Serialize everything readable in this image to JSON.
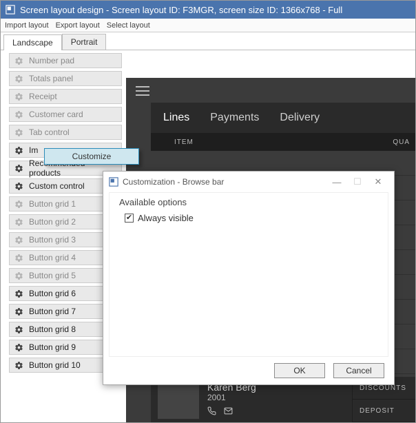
{
  "titlebar": {
    "text": "Screen layout design - Screen layout ID: F3MGR, screen size ID: 1366x768 - Full"
  },
  "toolbar": {
    "import": "Import layout",
    "export": "Export layout",
    "select": "Select layout"
  },
  "tabs": {
    "landscape": "Landscape",
    "portrait": "Portrait"
  },
  "sidebar": [
    {
      "label": "Number pad",
      "enabled": false
    },
    {
      "label": "Totals panel",
      "enabled": false
    },
    {
      "label": "Receipt",
      "enabled": false
    },
    {
      "label": "Customer card",
      "enabled": false
    },
    {
      "label": "Tab control",
      "enabled": false
    },
    {
      "label": "Im",
      "enabled": true
    },
    {
      "label": "Recommended products",
      "enabled": true
    },
    {
      "label": "Custom control",
      "enabled": true
    },
    {
      "label": "Button grid 1",
      "enabled": false
    },
    {
      "label": "Button grid 2",
      "enabled": false
    },
    {
      "label": "Button grid 3",
      "enabled": false
    },
    {
      "label": "Button grid 4",
      "enabled": false
    },
    {
      "label": "Button grid 5",
      "enabled": false
    },
    {
      "label": "Button grid 6",
      "enabled": true
    },
    {
      "label": "Button grid 7",
      "enabled": true
    },
    {
      "label": "Button grid 8",
      "enabled": true
    },
    {
      "label": "Button grid 9",
      "enabled": true
    },
    {
      "label": "Button grid 10",
      "enabled": true
    }
  ],
  "context_button": {
    "label": "Customize"
  },
  "preview": {
    "tabs": {
      "lines": "Lines",
      "payments": "Payments",
      "delivery": "Delivery"
    },
    "columns": {
      "item": "ITEM",
      "qty": "QUA"
    },
    "customer": {
      "name": "Karen Berg",
      "year": "2001"
    },
    "right": {
      "discounts": "DISCOUNTS",
      "deposit": "DEPOSIT"
    }
  },
  "dialog": {
    "title": "Customization - Browse bar",
    "section": "Available options",
    "option1": "Always visible",
    "ok": "OK",
    "cancel": "Cancel"
  }
}
